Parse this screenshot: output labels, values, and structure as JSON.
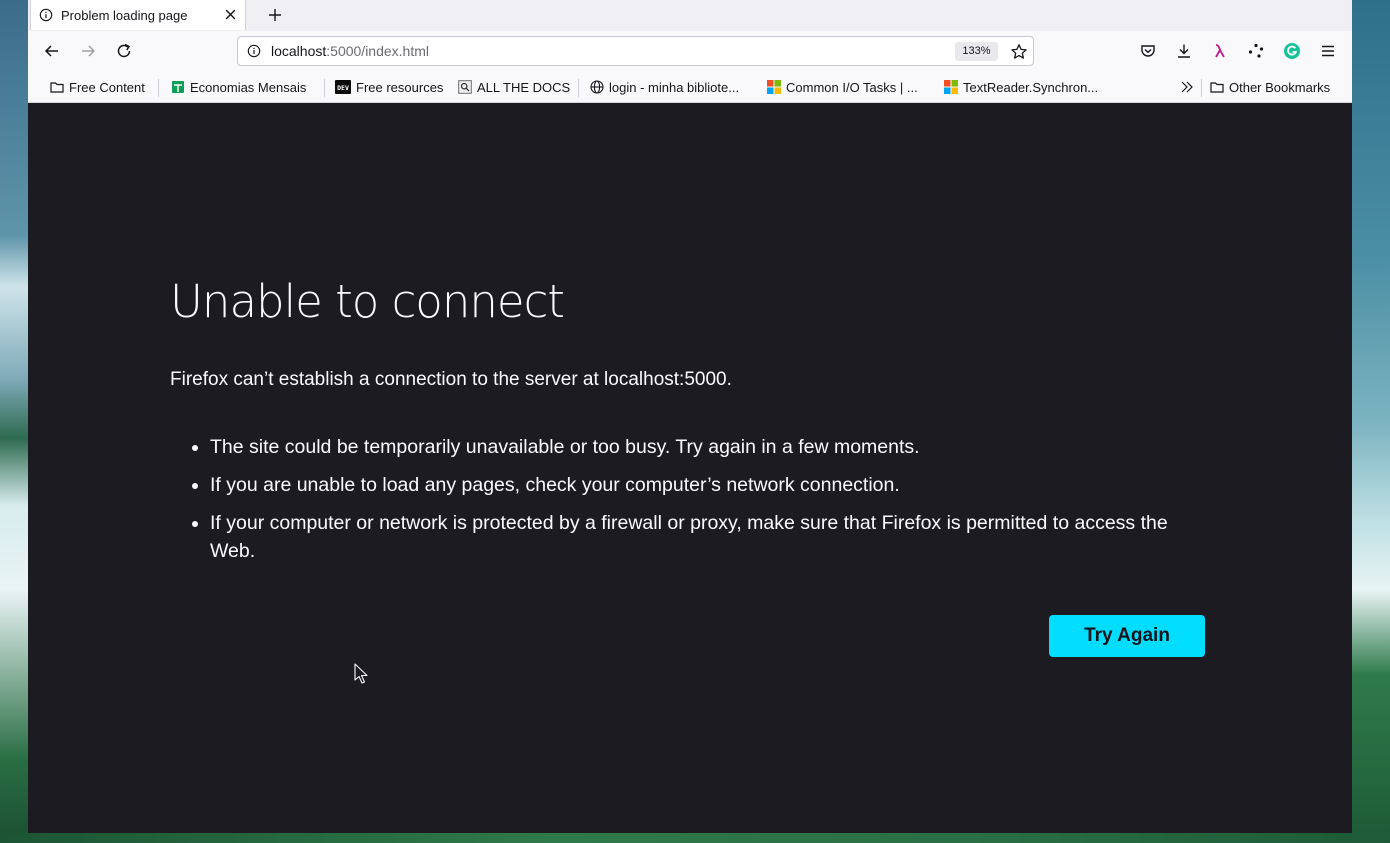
{
  "tab": {
    "title": "Problem loading page"
  },
  "urlbar": {
    "host": "localhost",
    "path": ":5000/index.html",
    "zoom": "133%"
  },
  "bookmarks": [
    {
      "label": "Free Content",
      "icon": "folder-icon"
    },
    {
      "label": "Economias Mensais",
      "icon": "sheets-icon"
    },
    {
      "label": "Free resources",
      "icon": "dev-icon"
    },
    {
      "label": "ALL THE DOCS",
      "icon": "docs-search-icon"
    },
    {
      "label": "login - minha bibliote...",
      "icon": "globe-icon"
    },
    {
      "label": "Common I/O Tasks | ...",
      "icon": "microsoft-icon"
    },
    {
      "label": "TextReader.Synchron...",
      "icon": "microsoft-icon"
    }
  ],
  "other_bookmarks": "Other Bookmarks",
  "error": {
    "title": "Unable to connect",
    "description": "Firefox can’t establish a connection to the server at localhost:5000.",
    "items": [
      "The site could be temporarily unavailable or too busy. Try again in a few moments.",
      "If you are unable to load any pages, check your computer’s network connection.",
      "If your computer or network is protected by a firewall or proxy, make sure that Firefox is permitted to access the Web."
    ],
    "button": "Try Again"
  },
  "colors": {
    "content_bg": "#1c1b22",
    "accent": "#00ddff",
    "text": "#fbfbfe"
  }
}
